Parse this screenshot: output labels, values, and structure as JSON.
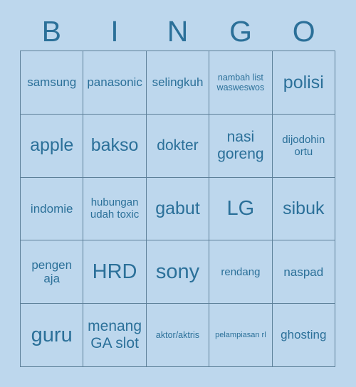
{
  "card": {
    "title": "BINGO",
    "background_color": "#bdd7ed",
    "text_color": "#2b7099",
    "border_color": "#5d8099"
  },
  "header": {
    "letters": [
      {
        "label": "B"
      },
      {
        "label": "I"
      },
      {
        "label": "N"
      },
      {
        "label": "G"
      },
      {
        "label": "O"
      }
    ]
  },
  "grid": {
    "rows": 5,
    "columns": 5,
    "cells": [
      {
        "text": "samsung",
        "size": "m"
      },
      {
        "text": "panasonic",
        "size": "m"
      },
      {
        "text": "selingkuh",
        "size": "m"
      },
      {
        "text": "nambah list wasweswos",
        "size": "xs"
      },
      {
        "text": "polisi",
        "size": "xl"
      },
      {
        "text": "apple",
        "size": "xl"
      },
      {
        "text": "bakso",
        "size": "xl"
      },
      {
        "text": "dokter",
        "size": "l"
      },
      {
        "text": "nasi goreng",
        "size": "l"
      },
      {
        "text": "dijodohin ortu",
        "size": "s"
      },
      {
        "text": "indomie",
        "size": "m"
      },
      {
        "text": "hubungan udah toxic",
        "size": "s"
      },
      {
        "text": "gabut",
        "size": "xl"
      },
      {
        "text": "LG",
        "size": "xxl"
      },
      {
        "text": "sibuk",
        "size": "xl"
      },
      {
        "text": "pengen aja",
        "size": "m"
      },
      {
        "text": "HRD",
        "size": "xxl"
      },
      {
        "text": "sony",
        "size": "xxl"
      },
      {
        "text": "rendang",
        "size": "s"
      },
      {
        "text": "naspad",
        "size": "m"
      },
      {
        "text": "guru",
        "size": "xxl"
      },
      {
        "text": "menang GA slot",
        "size": "l"
      },
      {
        "text": "aktor/aktris",
        "size": "xs"
      },
      {
        "text": "pelampiasan rl",
        "size": "xxs"
      },
      {
        "text": "ghosting",
        "size": "m"
      }
    ]
  }
}
